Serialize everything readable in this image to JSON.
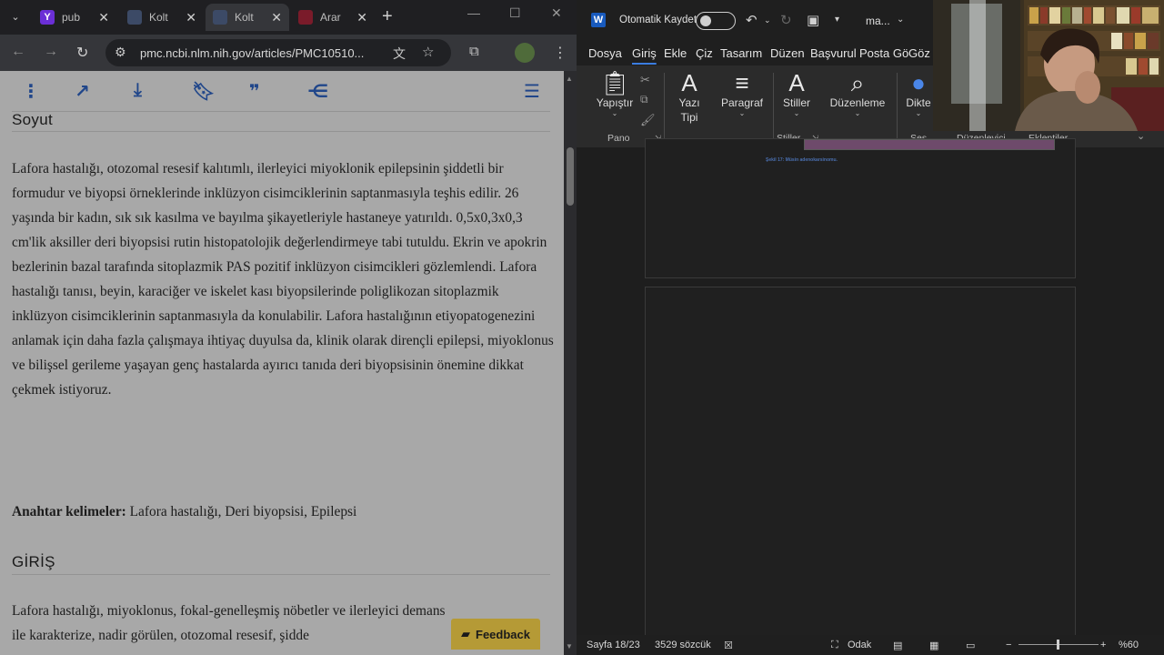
{
  "browser": {
    "tabs": [
      {
        "label": "pub",
        "favicon": "Y",
        "favicon_color": "#6b2fd6"
      },
      {
        "label": "Kolt",
        "favicon": "",
        "favicon_color": "#3c4a66"
      },
      {
        "label": "Kolt",
        "favicon": "",
        "favicon_color": "#3c4a66"
      },
      {
        "label": "Arar",
        "favicon": "",
        "favicon_color": "#7a1b2a"
      }
    ],
    "url": "pmc.ncbi.nlm.nih.gov/articles/PMC10510..."
  },
  "article": {
    "abstract_heading": "Soyut",
    "abstract_text": "Lafora hastalığı, otozomal resesif kalıtımlı, ilerleyici miyoklonik epilepsinin şiddetli bir formudur ve biyopsi örneklerinde inklüzyon cisimciklerinin saptanmasıyla teşhis edilir. 26 yaşında bir kadın, sık sık kasılma ve bayılma şikayetleriyle hastaneye yatırıldı. 0,5x0,3x0,3 cm'lik aksiller deri biyopsisi rutin histopatolojik değerlendirmeye tabi tutuldu. Ekrin ve apokrin bezlerinin bazal tarafında sitoplazmik PAS pozitif inklüzyon cisimcikleri gözlemlendi. Lafora hastalığı tanısı, beyin, karaciğer ve iskelet kası biyopsilerinde poliglikozan sitoplazmik inklüzyon cisimciklerinin saptanmasıyla da konulabilir. Lafora hastalığının etiyopatogenezini anlamak için daha fazla çalışmaya ihtiyaç duyulsa da, klinik olarak dirençli epilepsi, miyoklonus ve bilişsel gerileme yaşayan genç hastalarda ayırıcı tanıda deri biyopsisinin önemine dikkat çekmek istiyoruz.",
    "keywords_label": "Anahtar kelimeler:",
    "keywords_value": " Lafora hastalığı, Deri biyopsisi, Epilepsi",
    "intro_heading": "GİRİŞ",
    "intro_text": "Lafora hastalığı, miyoklonus, fokal-genelleşmiş nöbetler ve ilerleyici demans ile karakterize, nadir görülen, otozomal resesif, şidde",
    "feedback_label": "Feedback"
  },
  "word": {
    "autosave_label": "Otomatik Kaydet",
    "doc_name": "ma...",
    "menu": [
      "Dosya",
      "Giriş",
      "Ekle",
      "Çiz",
      "Tasarım",
      "Düzen",
      "Başvurul",
      "Posta Gö",
      "Göz"
    ],
    "ribbon": {
      "paste": "Yapıştır",
      "font": "Yazı",
      "font2": "Tipi",
      "paragraph": "Paragraf",
      "styles": "Stiller",
      "editing": "Düzenleme",
      "dictate": "Dikte"
    },
    "groups": {
      "clipboard": "Pano",
      "styles": "Stiller",
      "voice": "Ses",
      "editor": "Düzenleyici",
      "addins": "Eklentiler"
    },
    "caption": "Şekil 17: Müsin adenokarsinomu.",
    "status": {
      "page": "Sayfa 18/23",
      "words": "3529 sözcük",
      "focus": "Odak",
      "zoom": "%60"
    }
  }
}
